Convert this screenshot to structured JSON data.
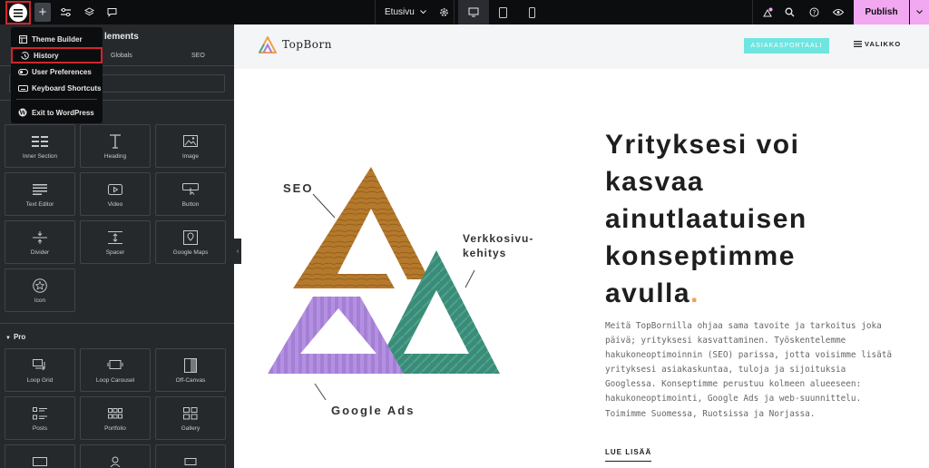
{
  "topbar": {
    "page_name": "Etusivu",
    "publish_label": "Publish",
    "icons": [
      "elementor-menu-icon",
      "add-icon",
      "site-settings-icon",
      "structure-layers-icon",
      "comments-icon",
      "settings-gear-icon",
      "desktop-icon",
      "tablet-icon",
      "mobile-icon",
      "notifications-icon",
      "search-icon",
      "help-icon",
      "preview-eye-icon",
      "chevron-down-icon"
    ]
  },
  "panel": {
    "title": "Elements",
    "title_visible": "lements",
    "tabs": [
      "Globals",
      "SEO"
    ]
  },
  "menu": {
    "items": [
      {
        "label": "Theme Builder",
        "icon": "theme-builder-icon"
      },
      {
        "label": "History",
        "icon": "history-icon"
      },
      {
        "label": "User Preferences",
        "icon": "user-preferences-icon"
      },
      {
        "label": "Keyboard Shortcuts",
        "icon": "keyboard-icon"
      },
      {
        "label": "Exit to WordPress",
        "icon": "wordpress-icon"
      }
    ]
  },
  "widgets_basic": [
    {
      "label": "Inner Section",
      "icon": "inner-section-icon"
    },
    {
      "label": "Heading",
      "icon": "heading-icon"
    },
    {
      "label": "Image",
      "icon": "image-icon"
    },
    {
      "label": "Text Editor",
      "icon": "text-editor-icon"
    },
    {
      "label": "Video",
      "icon": "video-icon"
    },
    {
      "label": "Button",
      "icon": "button-icon"
    },
    {
      "label": "Divider",
      "icon": "divider-icon"
    },
    {
      "label": "Spacer",
      "icon": "spacer-icon"
    },
    {
      "label": "Google Maps",
      "icon": "google-maps-icon"
    },
    {
      "label": "Icon",
      "icon": "star-icon"
    }
  ],
  "pro_section": {
    "label": "Pro",
    "widgets": [
      {
        "label": "Loop Grid",
        "icon": "loop-grid-icon"
      },
      {
        "label": "Loop Carousel",
        "icon": "loop-carousel-icon"
      },
      {
        "label": "Off-Canvas",
        "icon": "off-canvas-icon"
      },
      {
        "label": "Posts",
        "icon": "posts-icon"
      },
      {
        "label": "Portfolio",
        "icon": "portfolio-icon"
      },
      {
        "label": "Gallery",
        "icon": "gallery-icon"
      }
    ]
  },
  "site": {
    "logo": "TopBorn",
    "portal_button": "ASIAKASPORTAALI",
    "menu_label": "VALIKKO",
    "headline": "Yrityksesi voi kasvaa ainutlaatuisen konseptimme avulla",
    "headline_dot": ".",
    "paragraph": "Meitä TopBornilla ohjaa sama tavoite ja tarkoitus joka päivä; yrityksesi kasvattaminen. Työskentelemme hakukoneoptimoinnin (SEO) parissa, jotta voisimme lisätä yrityksesi asiakaskuntaa, tuloja ja sijoituksia Googlessa. Konseptimme perustuu kolmeen alueeseen: hakukoneoptimointi, Google Ads ja web-suunnittelu. Toimimme Suomessa, Ruotsissa ja Norjassa.",
    "read_more": "LUE LISÄÄ",
    "graphic_labels": {
      "seo": "SEO",
      "web_line1": "Verkkosivu-",
      "web_line2": "kehitys",
      "ads": "Google Ads"
    }
  },
  "colors": {
    "accent": "#f1a8f1",
    "highlight": "#d0252c",
    "portal": "#6ee5e0",
    "dot": "#f0a04b",
    "sidebar": "#26292c"
  }
}
